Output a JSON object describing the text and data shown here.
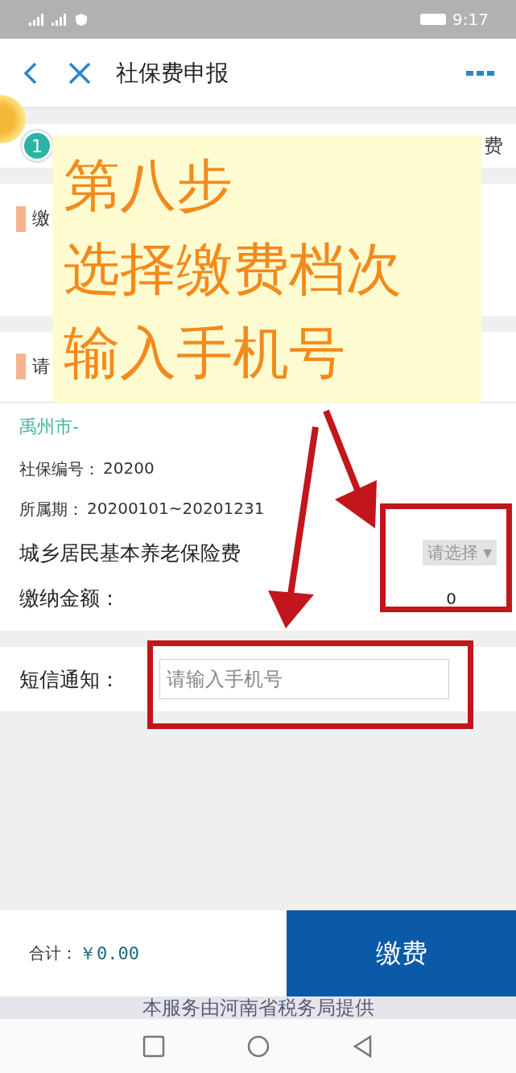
{
  "status_bar": {
    "time": "9:17"
  },
  "header": {
    "title": "社保费申报"
  },
  "steps": [
    {
      "number": "1",
      "selected": true
    },
    {
      "label": "费",
      "selected": false
    }
  ],
  "payer_section": {
    "title": "缴"
  },
  "level_section": {
    "title": "请"
  },
  "item": {
    "area": "禹州市-",
    "fields": [
      {
        "label": "社保编号：",
        "value": "20200"
      },
      {
        "label": "所属期：",
        "value": "20200101~20201231"
      }
    ],
    "insurance": "城乡居民基本养老保险费",
    "level_select": {
      "placeholder": "请选择",
      "arrow": "▼"
    },
    "amount_label": "缴纳金额：",
    "amount": "0"
  },
  "sms": {
    "label": "短信通知：",
    "placeholder": "请输入手机号"
  },
  "bottom": {
    "total_label": "合计：",
    "total": "￥0.00",
    "pay_button": "缴费"
  },
  "footer": "本服务由河南省税务局提供",
  "annotation": {
    "lines": [
      "第八步",
      "选择缴费档次",
      "输入手机号"
    ]
  }
}
